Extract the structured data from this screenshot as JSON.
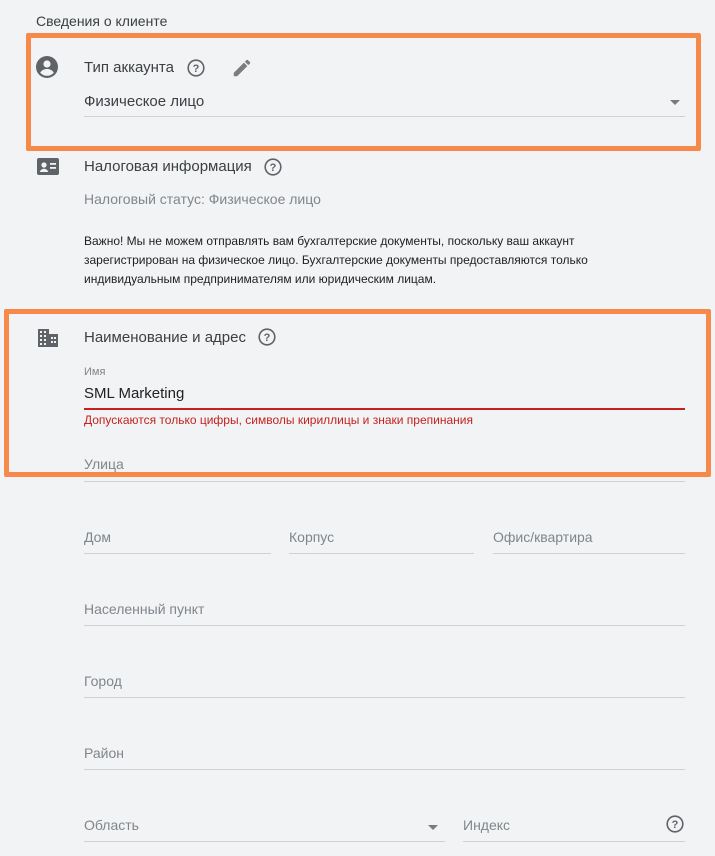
{
  "section": {
    "title": "Сведения о клиенте"
  },
  "account_type": {
    "label": "Тип аккаунта",
    "value": "Физическое лицо"
  },
  "tax_info": {
    "label": "Налоговая информация",
    "status": "Налоговый статус: Физическое лицо",
    "notice": "Важно! Мы не можем отправлять вам бухгалтерские документы, поскольку ваш аккаунт зарегистрирован на физическое лицо. Бухгалтерские документы предоставляются только индивидуальным предпринимателям или юридическим лицам."
  },
  "name_address": {
    "label": "Наименование и адрес",
    "name_label": "Имя",
    "name_value": "SML Marketing",
    "name_error": "Допускаются только цифры, символы кириллицы и знаки препинания",
    "street_placeholder": "Улица",
    "house_placeholder": "Дом",
    "building_placeholder": "Корпус",
    "office_placeholder": "Офис/квартира",
    "locality_placeholder": "Населенный пункт",
    "city_placeholder": "Город",
    "district_placeholder": "Район",
    "region_placeholder": "Область",
    "index_placeholder": "Индекс"
  },
  "colors": {
    "highlight": "#f7894a",
    "error": "#c5221f",
    "background": "#f1f3f4"
  },
  "icons": [
    "account-circle-icon",
    "help-icon",
    "edit-pencil-icon",
    "id-card-icon",
    "building-icon",
    "dropdown-caret-icon"
  ]
}
